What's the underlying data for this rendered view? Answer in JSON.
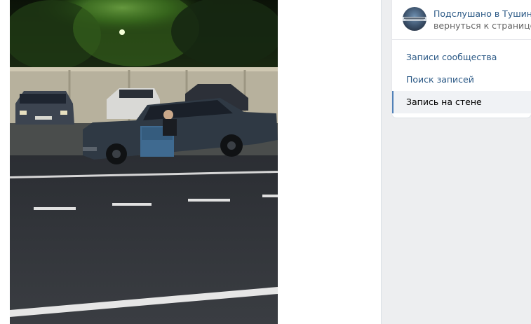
{
  "colors": {
    "page_bg": "#edeef0",
    "link": "#2a5885",
    "active_marker": "#5181b8",
    "active_bg": "#f0f2f5"
  },
  "post": {
    "photo": {
      "description_icon": "photo-icon"
    }
  },
  "sidebar": {
    "group": {
      "name": "Подслушано в Тушино",
      "back_link": "вернуться к странице"
    },
    "nav": [
      {
        "label": "Записи сообщества",
        "active": false
      },
      {
        "label": "Поиск записей",
        "active": false
      },
      {
        "label": "Запись на стене",
        "active": true
      }
    ]
  }
}
